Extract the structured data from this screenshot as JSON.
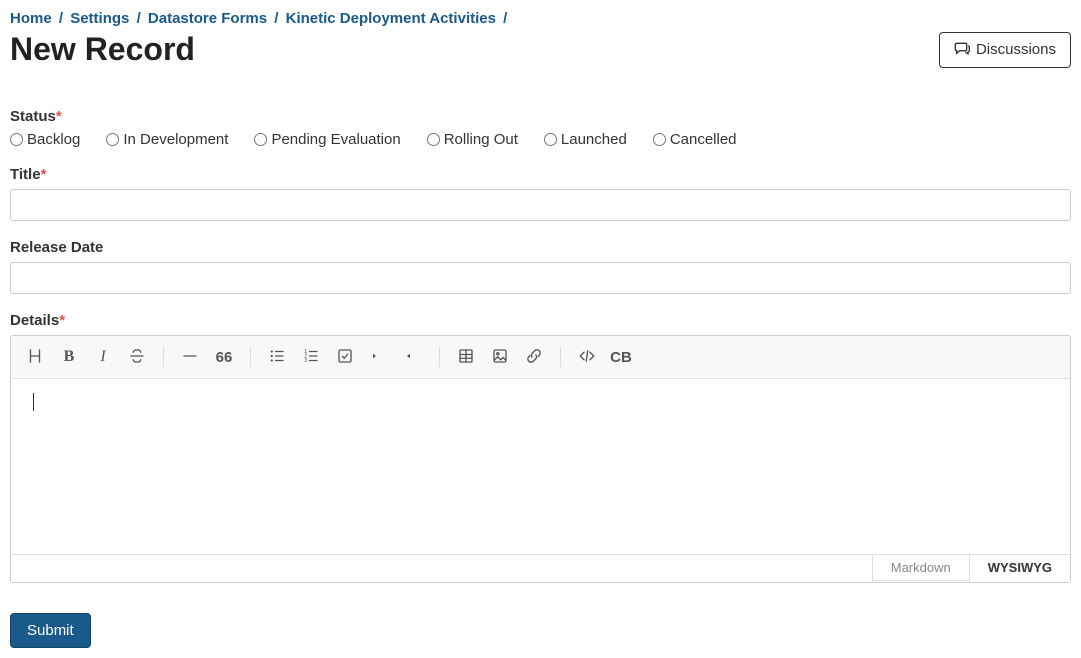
{
  "breadcrumb": {
    "items": [
      "Home",
      "Settings",
      "Datastore Forms",
      "Kinetic Deployment Activities"
    ],
    "sep": "/"
  },
  "header": {
    "title": "New Record",
    "discussions_label": "Discussions"
  },
  "form": {
    "status": {
      "label": "Status",
      "options": [
        "Backlog",
        "In Development",
        "Pending Evaluation",
        "Rolling Out",
        "Launched",
        "Cancelled"
      ]
    },
    "title": {
      "label": "Title",
      "value": ""
    },
    "release_date": {
      "label": "Release Date",
      "value": ""
    },
    "details": {
      "label": "Details",
      "value": ""
    },
    "editor_modes": {
      "markdown": "Markdown",
      "wysiwyg": "WYSIWYG"
    },
    "toolbar": {
      "quote_glyph": "66",
      "cb_glyph": "CB"
    },
    "submit_label": "Submit"
  }
}
